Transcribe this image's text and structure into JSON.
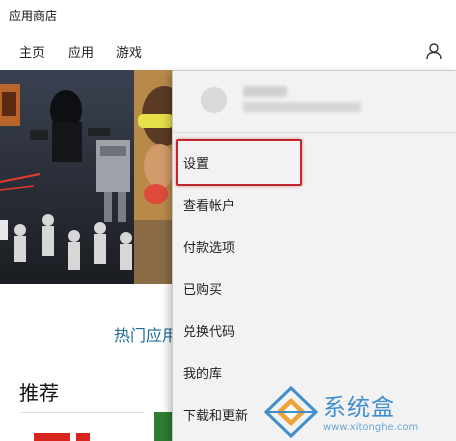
{
  "app": {
    "title": "应用商店"
  },
  "nav": {
    "tabs": [
      "主页",
      "应用",
      "游戏"
    ],
    "account_icon": "user-icon"
  },
  "content": {
    "section_link": "热门应用",
    "section_title": "推荐"
  },
  "menu": {
    "items": [
      "设置",
      "查看帐户",
      "付款选项",
      "已购买",
      "兑换代码",
      "我的库",
      "下载和更新"
    ],
    "highlight_color": "#c0272d"
  },
  "watermark": {
    "brand": "系统盒",
    "url": "www.xitonghe.com"
  }
}
